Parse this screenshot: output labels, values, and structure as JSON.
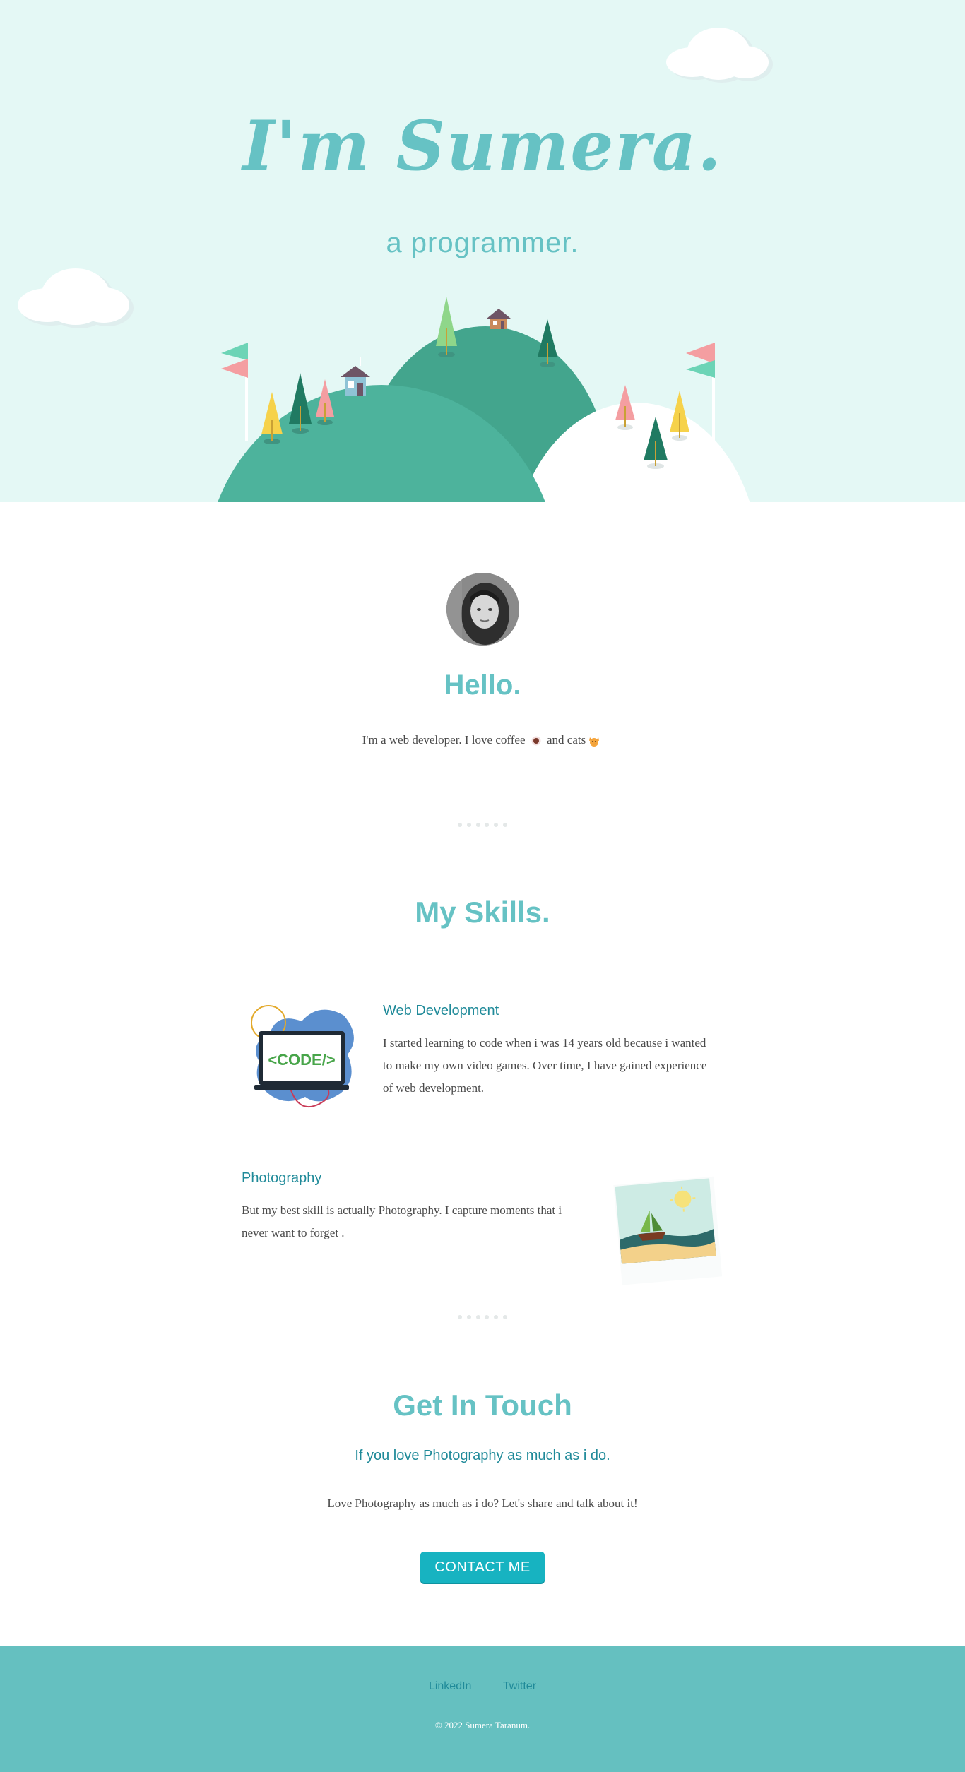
{
  "hero": {
    "title": "I'm Sumera.",
    "subtitle": "a programmer."
  },
  "about": {
    "greeting": "Hello.",
    "intro_prefix": "I'm a web developer. I love coffee",
    "intro_middle": "and cats",
    "avatar_icon": "avatar-photo"
  },
  "skills": {
    "title": "My Skills.",
    "items": [
      {
        "heading": "Web Development",
        "text": "I started learning to code when i was 14 years old because i wanted to make my own video games. Over time, I have gained experience of web development.",
        "image_text": "<CODE/>",
        "icon": "laptop-code-icon"
      },
      {
        "heading": "Photography",
        "text": "But my best skill is actually Photography. I capture moments that i never want to forget .",
        "icon": "beach-photo-icon"
      }
    ]
  },
  "contact": {
    "title": "Get In Touch",
    "subtitle": "If you love Photography as much as i do.",
    "text": "Love Photography as much as i do? Let's share and talk about it!",
    "button_label": "CONTACT ME"
  },
  "footer": {
    "links": [
      "LinkedIn",
      "Twitter"
    ],
    "copyright": "© 2022 Sumera Taranum."
  },
  "colors": {
    "hero_bg": "#e4f8f5",
    "accent": "#66c2c4",
    "heading_dark": "#1f8a99",
    "button": "#17b3c1",
    "footer_bg": "#65c0c0",
    "hill_green": "#4db39c"
  }
}
